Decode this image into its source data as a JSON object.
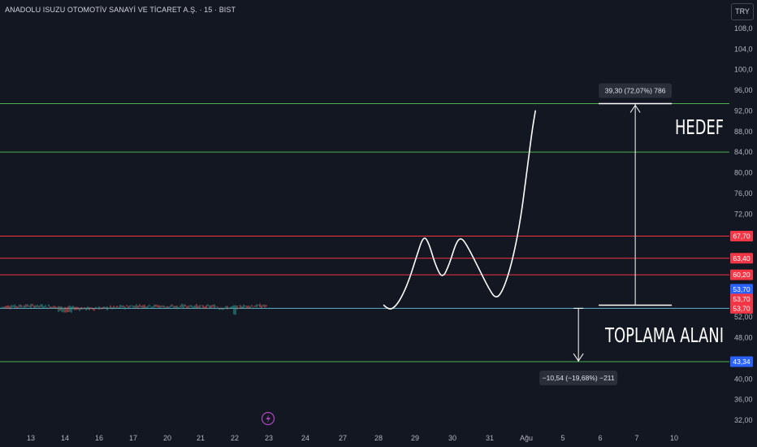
{
  "header": {
    "title": "ANADOLU ISUZU OTOMOTİV SANAYİ VE TİCARET A.Ş. · 15 · BIST",
    "currency": "TRY"
  },
  "colors": {
    "background": "#131722",
    "green_line": "#4caf50",
    "red_line": "#f23645",
    "cyan_line": "#5fb4c9",
    "blue_tag": "#2962ff",
    "red_tag": "#f23645"
  },
  "annotations": {
    "target_label": "HEDEF",
    "accumulation_label": "TOPLAMA ALANI",
    "up_measure": "39,30 (72,07%) 786",
    "down_measure": "−10,54 (−19,68%) −211"
  },
  "chart_data": {
    "type": "line",
    "y_ticks": [
      "108,0",
      "104,0",
      "100,0",
      "96,00",
      "92,00",
      "88,00",
      "84,00",
      "80,00",
      "76,00",
      "72,00",
      "52,00",
      "48,00",
      "40,00",
      "36,00",
      "32,00"
    ],
    "x_ticks": [
      "13",
      "14",
      "16",
      "17",
      "20",
      "21",
      "22",
      "23",
      "24",
      "27",
      "28",
      "29",
      "30",
      "31",
      "Ağu",
      "5",
      "6",
      "7",
      "10"
    ],
    "horizontal_levels": [
      {
        "value": 93.4,
        "color": "green"
      },
      {
        "value": 84.0,
        "color": "green"
      },
      {
        "value": 67.7,
        "color": "red",
        "tag": "67,70"
      },
      {
        "value": 63.4,
        "color": "red",
        "tag": "63,40"
      },
      {
        "value": 60.2,
        "color": "red",
        "tag": "60,20"
      },
      {
        "value": 53.7,
        "color": "cyan",
        "tag": "53,70"
      },
      {
        "value": 43.34,
        "color": "green",
        "tag": "43,34"
      }
    ],
    "price_tags": [
      {
        "label": "67,70",
        "value": 67.7,
        "color": "red"
      },
      {
        "label": "63,40",
        "value": 63.4,
        "color": "red"
      },
      {
        "label": "60,20",
        "value": 60.2,
        "color": "red"
      },
      {
        "label": "53,70",
        "value": 57.4,
        "color": "blue"
      },
      {
        "label": "53,70",
        "value": 55.5,
        "color": "red"
      },
      {
        "label": "53,70",
        "value": 53.7,
        "color": "red"
      },
      {
        "label": "43,34",
        "value": 43.34,
        "color": "blue"
      }
    ],
    "projected_path": [
      [
        23.25,
        54.3
      ],
      [
        23.4,
        53.3
      ],
      [
        23.6,
        54.1
      ],
      [
        23.8,
        56.3
      ],
      [
        24.0,
        59.5
      ],
      [
        24.2,
        63.8
      ],
      [
        24.4,
        67.8
      ],
      [
        24.55,
        66.5
      ],
      [
        24.75,
        62.0
      ],
      [
        24.95,
        59.4
      ],
      [
        25.15,
        62.2
      ],
      [
        25.35,
        66.5
      ],
      [
        25.5,
        67.5
      ],
      [
        25.7,
        65.5
      ],
      [
        26.0,
        61.5
      ],
      [
        26.3,
        57.5
      ],
      [
        26.5,
        55.5
      ],
      [
        26.7,
        57.0
      ],
      [
        26.95,
        62.0
      ],
      [
        27.2,
        70.0
      ],
      [
        27.4,
        80.0
      ],
      [
        27.55,
        88.0
      ],
      [
        27.65,
        92.0
      ]
    ],
    "measure_up": {
      "x": 30.55,
      "from": 54.3,
      "to": 93.4
    },
    "measure_down": {
      "x": 28.9,
      "from": 53.7,
      "to": 43.34
    }
  }
}
